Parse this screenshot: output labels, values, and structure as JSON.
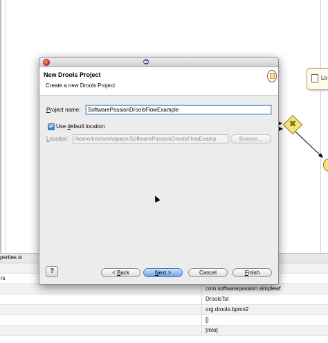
{
  "canvas": {
    "node_label": "Lo",
    "gateway_symbol": "✖"
  },
  "properties": {
    "tab_label": "perties",
    "tab_close": "☒",
    "tab_extra": "",
    "rows": [
      {
        "key": "",
        "value": ""
      },
      {
        "key": "rs",
        "value": "{}"
      },
      {
        "key": "",
        "value": "com.softwarepassion.simplewf"
      },
      {
        "key": "",
        "value": "DroolsTst"
      },
      {
        "key": "",
        "value": "org.drools.bpmn2"
      },
      {
        "key": "",
        "value": "[]"
      },
      {
        "key": "",
        "value": "[mto]"
      }
    ]
  },
  "dialog": {
    "title": "New Drools Project",
    "description": "Create a new Drools Project",
    "project_name": {
      "label_mnemonic": "P",
      "label_rest": "roject name:",
      "value": "SoftwarePassionDroolsFlowExample"
    },
    "default_location": {
      "checked_glyph": "✔",
      "label_prefix": "Use ",
      "label_mnemonic": "d",
      "label_rest": "efault location"
    },
    "location": {
      "label_mnemonic": "L",
      "label_rest": "ocation:",
      "value": "/home/kris/workspace/SoftwarePassionDroolsFlowExamp"
    },
    "buttons": {
      "browse": "Browse...",
      "help": "?",
      "back_prefix": "< ",
      "back_mnemonic": "B",
      "back_rest": "ack",
      "next_mnemonic": "N",
      "next_rest": "ext >",
      "cancel": "Cancel",
      "finish_mnemonic": "F",
      "finish_rest": "inish"
    }
  },
  "colors": {
    "dialog_bg": "#ececec",
    "default_button": "#6aa3e6",
    "gateway": "#f2e77a",
    "node_bg": "#fffbe6"
  }
}
